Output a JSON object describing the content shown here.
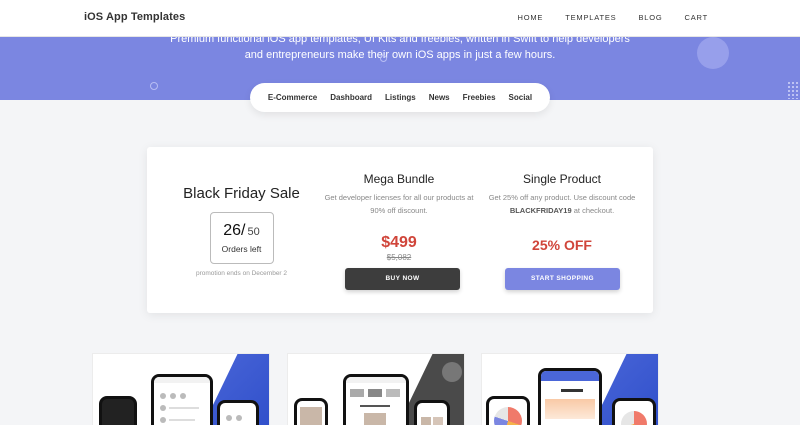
{
  "brand": "iOS App Templates",
  "nav": [
    "HOME",
    "TEMPLATES",
    "BLOG",
    "CART"
  ],
  "hero": {
    "line1": "Premium functional iOS app templates, UI Kits and freebies, written in Swift to help developers",
    "line2": "and entrepreneurs make their own iOS apps in just a few hours."
  },
  "categories": [
    "E-Commerce",
    "Dashboard",
    "Listings",
    "News",
    "Freebies",
    "Social"
  ],
  "promo": {
    "sale_title": "Black Friday Sale",
    "orders_remaining": "26/",
    "orders_total": "50",
    "orders_label": "Orders left",
    "ends": "promotion ends on December 2",
    "bundle": {
      "title": "Mega Bundle",
      "desc": "Get developer licenses for all our products at 90% off discount.",
      "price": "$499",
      "old_price": "$5,082",
      "button": "BUY NOW"
    },
    "single": {
      "title": "Single Product",
      "desc_before": "Get 25% off any product. Use discount code ",
      "code": "BLACKFRIDAY19",
      "desc_after": " at checkout.",
      "discount": "25% OFF",
      "button": "START SHOPPING"
    }
  },
  "colors": {
    "accent": "#7b86e1",
    "price_red": "#d0453a",
    "dark_button": "#3d3d3d",
    "wedge_blue": "#3b57cf"
  }
}
